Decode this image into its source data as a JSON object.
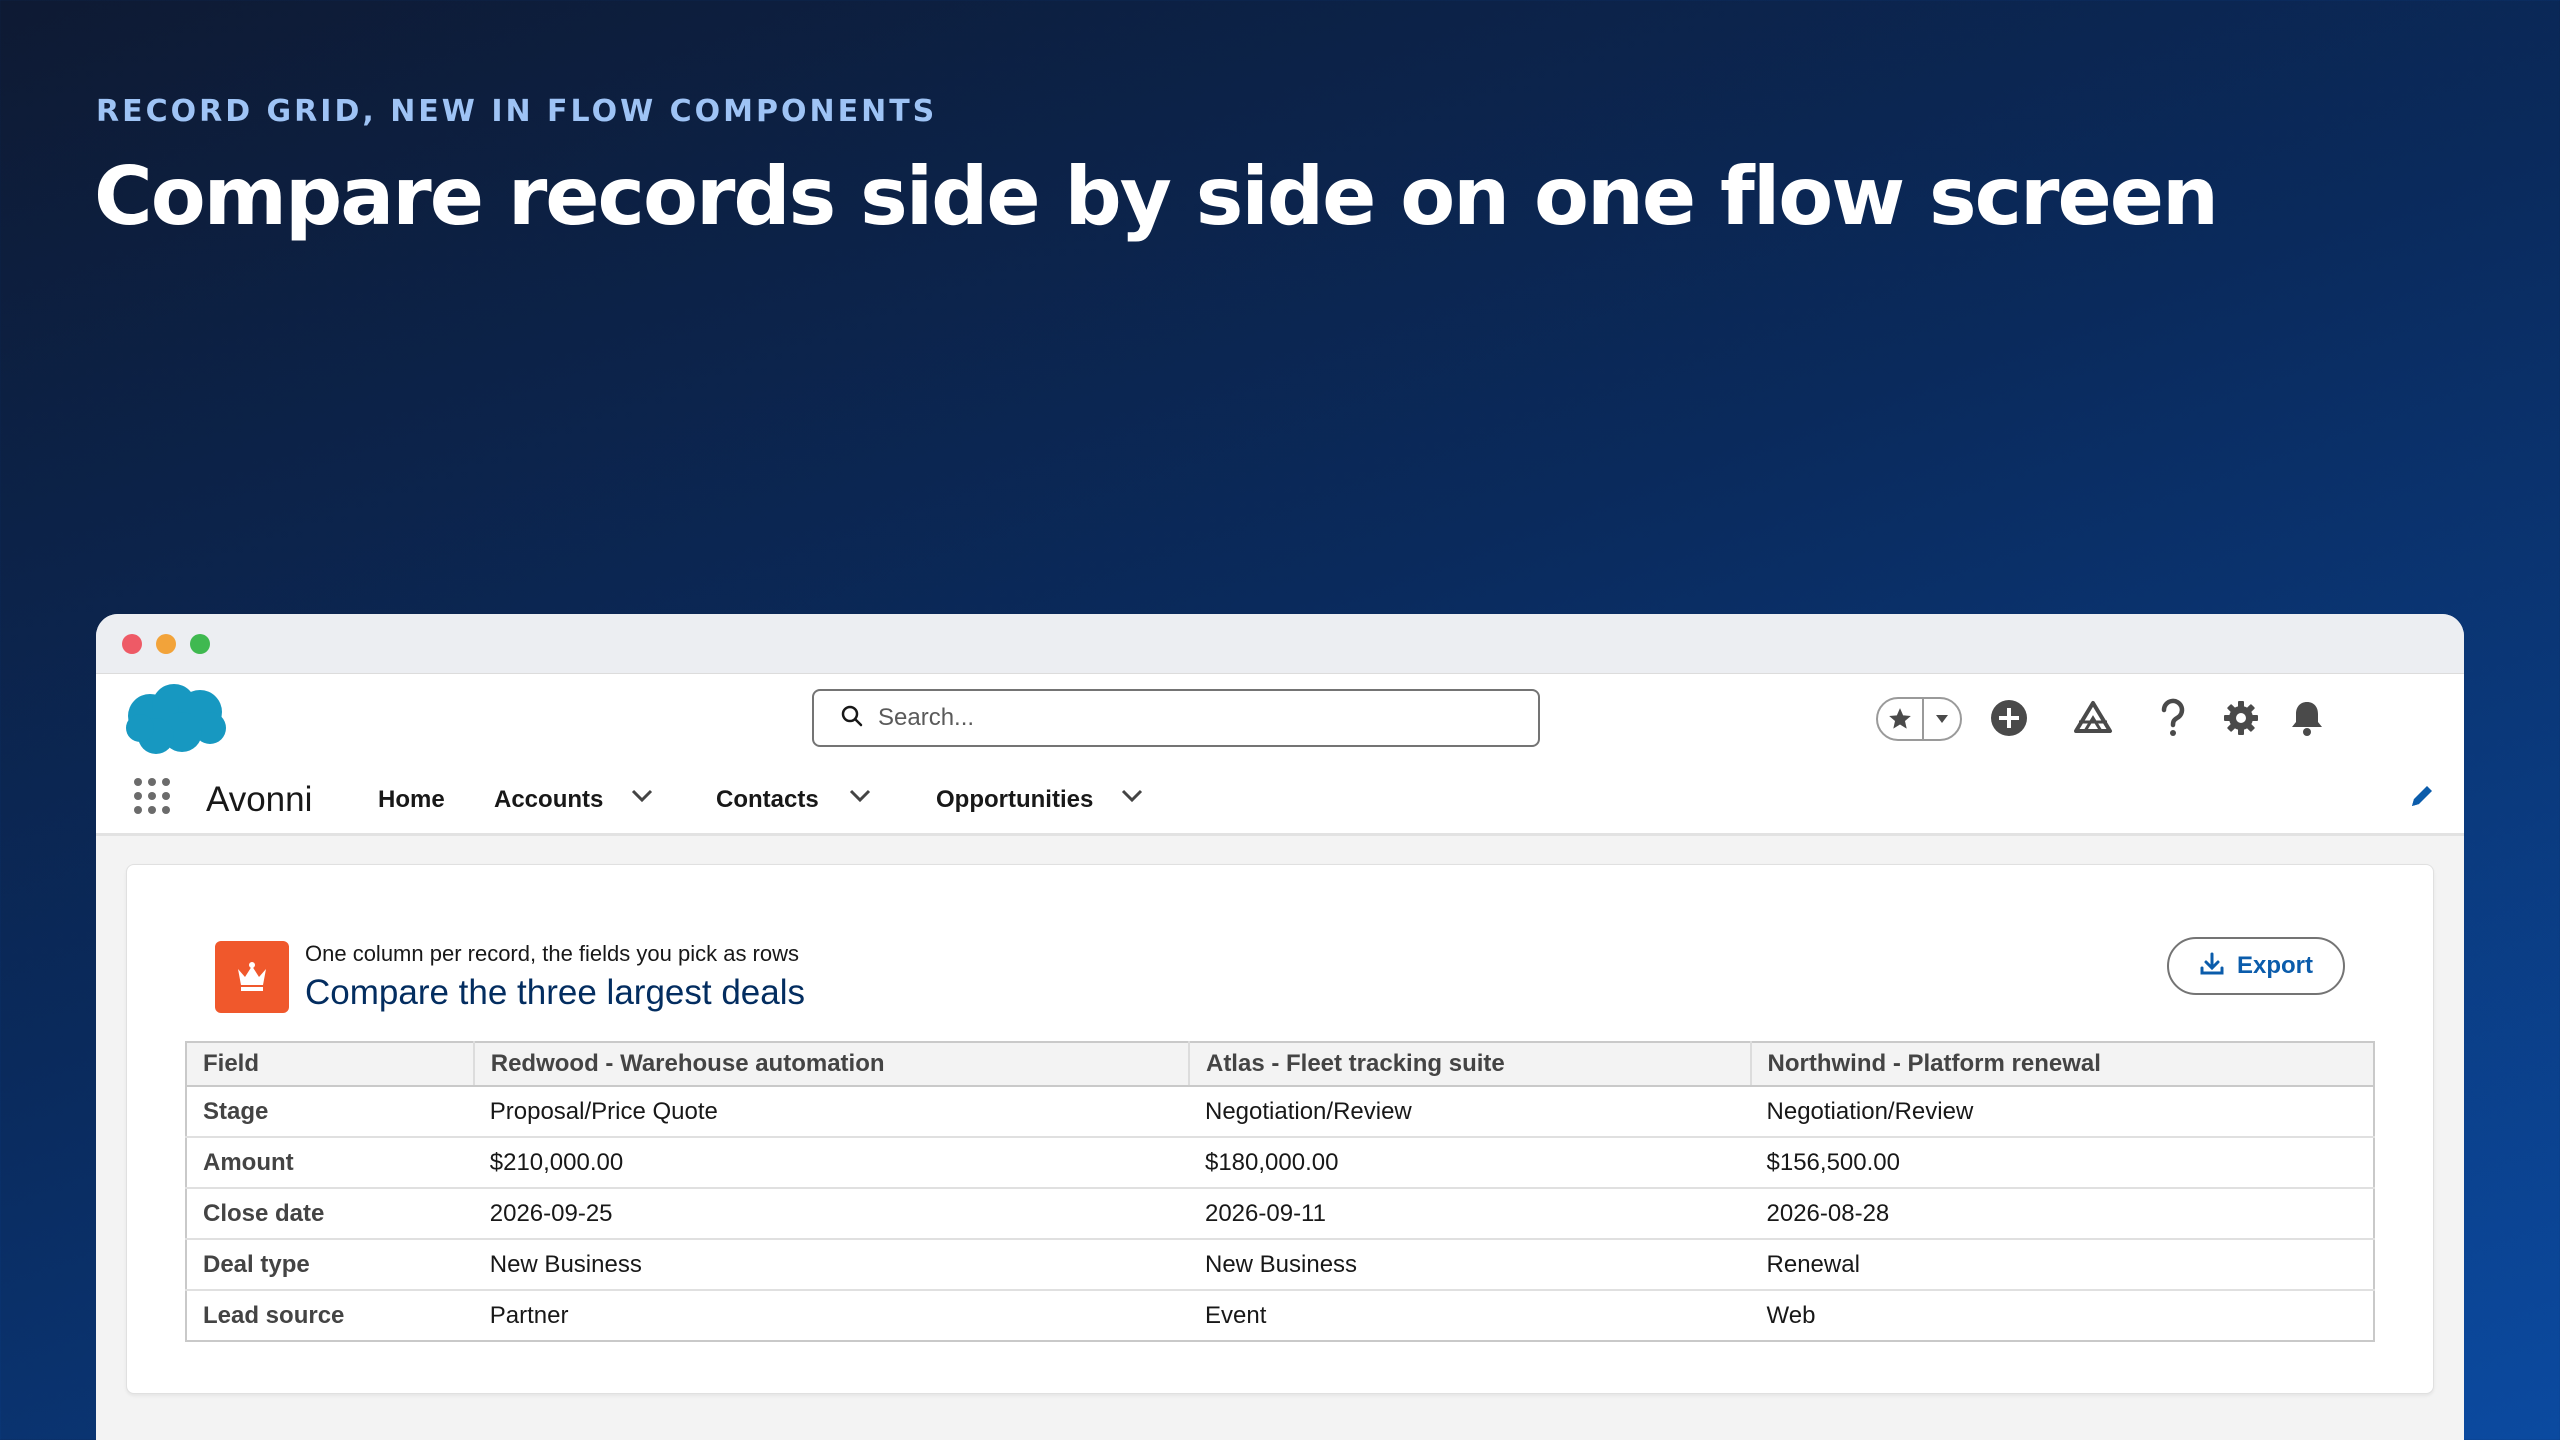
{
  "hero": {
    "eyebrow": "RECORD GRID, NEW IN FLOW COMPONENTS",
    "headline": "Compare records side by side on one flow screen"
  },
  "header": {
    "search_placeholder": "Search..."
  },
  "nav": {
    "app_name": "Avonni",
    "items": [
      {
        "label": "Home"
      },
      {
        "label": "Accounts"
      },
      {
        "label": "Contacts"
      },
      {
        "label": "Opportunities"
      }
    ]
  },
  "card": {
    "subtitle": "One column per record, the fields you pick as rows",
    "title": "Compare the three largest deals",
    "export_label": "Export",
    "icon": "crown-icon",
    "icon_color": "#f0582c"
  },
  "table": {
    "columns": [
      "Field",
      "Redwood - Warehouse automation",
      "Atlas - Fleet tracking suite",
      "Northwind - Platform renewal"
    ],
    "rows": [
      [
        "Stage",
        "Proposal/Price Quote",
        "Negotiation/Review",
        "Negotiation/Review"
      ],
      [
        "Amount",
        "$210,000.00",
        "$180,000.00",
        "$156,500.00"
      ],
      [
        "Close date",
        "2026-09-25",
        "2026-09-11",
        "2026-08-28"
      ],
      [
        "Deal type",
        "New Business",
        "New Business",
        "Renewal"
      ],
      [
        "Lead source",
        "Partner",
        "Event",
        "Web"
      ]
    ]
  },
  "colors": {
    "brand_blue": "#0b5cab",
    "salesforce_cloud": "#1798c1"
  }
}
